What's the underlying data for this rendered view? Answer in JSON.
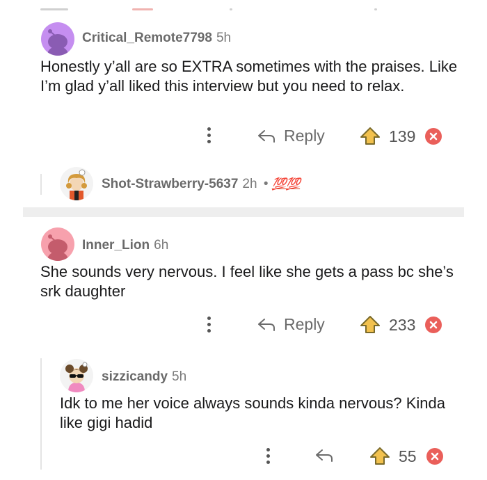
{
  "comments": [
    {
      "username": "Critical_Remote7798",
      "time": "5h",
      "body": "Honestly y’all are so EXTRA sometimes with the praises. Like I’m glad y’all liked this interview but you need to relax.",
      "reply_label": "Reply",
      "score": "139",
      "avatar_color": "#c58ef0"
    },
    {
      "username": "Shot-Strawberry-5637",
      "time": "2h",
      "meta_sep": "•",
      "flair": "💯💯"
    },
    {
      "username": "Inner_Lion",
      "time": "6h",
      "body": "She sounds very nervous. I feel like she gets a pass bc she’s srk daughter",
      "reply_label": "Reply",
      "score": "233",
      "avatar_color": "#f7a1ad"
    },
    {
      "username": "sizzicandy",
      "time": "5h",
      "body": "Idk to me her voice always sounds kinda nervous? Kinda like gigi hadid",
      "score": "55"
    }
  ],
  "icons": {
    "more": "vertical-dots-icon",
    "reply": "reply-arrow-icon",
    "upvote": "upvote-icon",
    "downvote": "downvote-icon"
  },
  "colors": {
    "upvote": "#f2c14e",
    "downvote": "#ea5f5a"
  }
}
